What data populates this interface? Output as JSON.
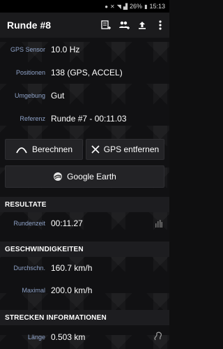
{
  "status_bar": {
    "battery": "26%",
    "time": "15:13"
  },
  "app_bar": {
    "title": "Runde #8"
  },
  "info": {
    "gps_sensor": {
      "label": "GPS Sensor",
      "value": "10.0 Hz"
    },
    "positionen": {
      "label": "Positionen",
      "value": "138 (GPS, ACCEL)"
    },
    "umgebung": {
      "label": "Umgebung",
      "value": "Gut"
    },
    "referenz": {
      "label": "Referenz",
      "value": "Runde #7 - 00:11.03"
    }
  },
  "buttons": {
    "berechnen": "Berechnen",
    "gps_entfernen": "GPS entfernen",
    "google_earth": "Google Earth"
  },
  "sections": {
    "resultate": "RESULTATE",
    "geschwindigkeiten": "GESCHWINDIGKEITEN",
    "strecken": "STRECKEN INFORMATIONEN"
  },
  "resultate": {
    "rundenzeit": {
      "label": "Rundenzeit",
      "value": "00:11.27"
    }
  },
  "geschwindigkeiten": {
    "durchschn": {
      "label": "Durchschn.",
      "value": "160.7 km/h"
    },
    "maximal": {
      "label": "Maximal",
      "value": "200.0 km/h"
    }
  },
  "strecken": {
    "laenge": {
      "label": "Länge",
      "value": "0.503 km"
    }
  }
}
